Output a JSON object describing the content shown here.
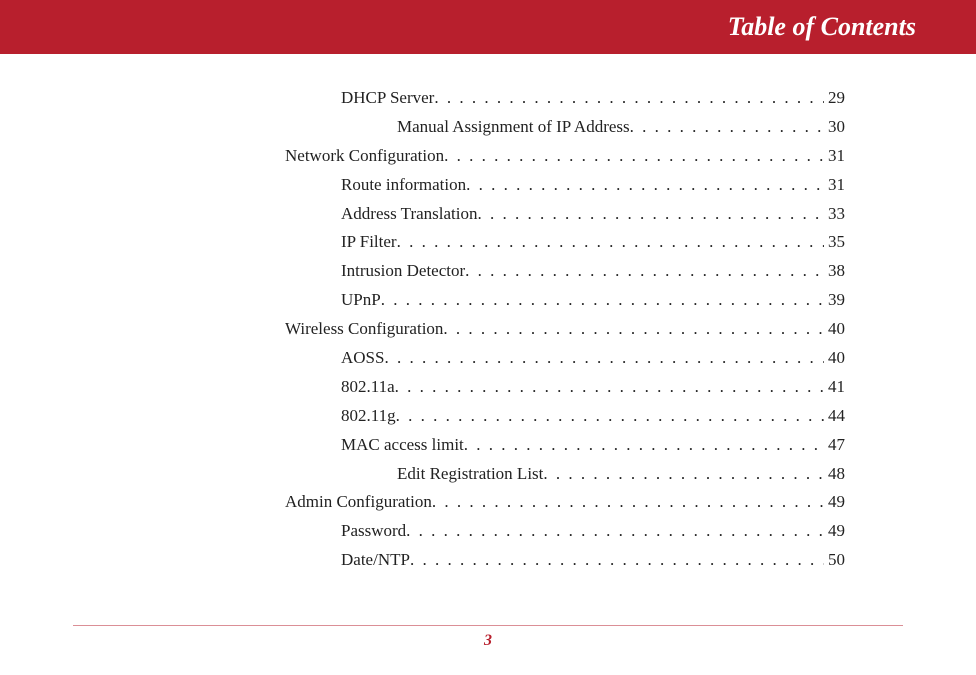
{
  "header": {
    "title": "Table of Contents"
  },
  "toc": [
    {
      "level": 2,
      "title": "DHCP Server",
      "page": "29"
    },
    {
      "level": 3,
      "title": "Manual Assignment of IP Address",
      "page": "30"
    },
    {
      "level": 1,
      "title": "Network Configuration",
      "page": "31"
    },
    {
      "level": 2,
      "title": "Route information",
      "page": "31"
    },
    {
      "level": 2,
      "title": "Address Translation",
      "page": "33"
    },
    {
      "level": 2,
      "title": "IP Filter",
      "page": "35"
    },
    {
      "level": 2,
      "title": "Intrusion Detector",
      "page": "38"
    },
    {
      "level": 2,
      "title": "UPnP",
      "page": "39"
    },
    {
      "level": 1,
      "title": "Wireless Configuration",
      "page": "40"
    },
    {
      "level": 2,
      "title": "AOSS",
      "page": "40"
    },
    {
      "level": 2,
      "title": "802.11a",
      "page": "41"
    },
    {
      "level": 2,
      "title": "802.11g",
      "page": "44"
    },
    {
      "level": 2,
      "title": "MAC access limit",
      "page": "47"
    },
    {
      "level": 3,
      "title": "Edit Registration List",
      "page": "48"
    },
    {
      "level": 1,
      "title": "Admin Configuration",
      "page": "49"
    },
    {
      "level": 2,
      "title": "Password",
      "page": "49"
    },
    {
      "level": 2,
      "title": "Date/NTP",
      "page": "50"
    }
  ],
  "footer": {
    "page_number": "3"
  }
}
